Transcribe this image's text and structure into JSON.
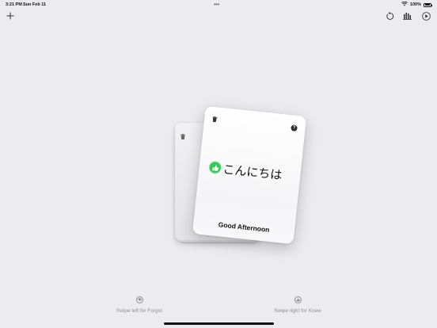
{
  "status_bar": {
    "time": "3:21 PM",
    "date": "Sun Feb 11",
    "battery": "100%"
  },
  "toolbar": {
    "add_icon": "plus-icon",
    "reset_icon": "rotate-ccw-icon",
    "stats_icon": "bar-chart-icon",
    "play_icon": "play-circle-icon"
  },
  "card": {
    "word": "こんにちは",
    "meaning": "Good Afternoon",
    "help": "?",
    "status_color": "#34c759"
  },
  "hints": {
    "left": "Swipe left for Forgot",
    "right": "Swipe right for Knew"
  },
  "colors": {
    "background": "#ebebf0",
    "accent_green": "#34c759",
    "hint_gray": "#8e8e93"
  }
}
